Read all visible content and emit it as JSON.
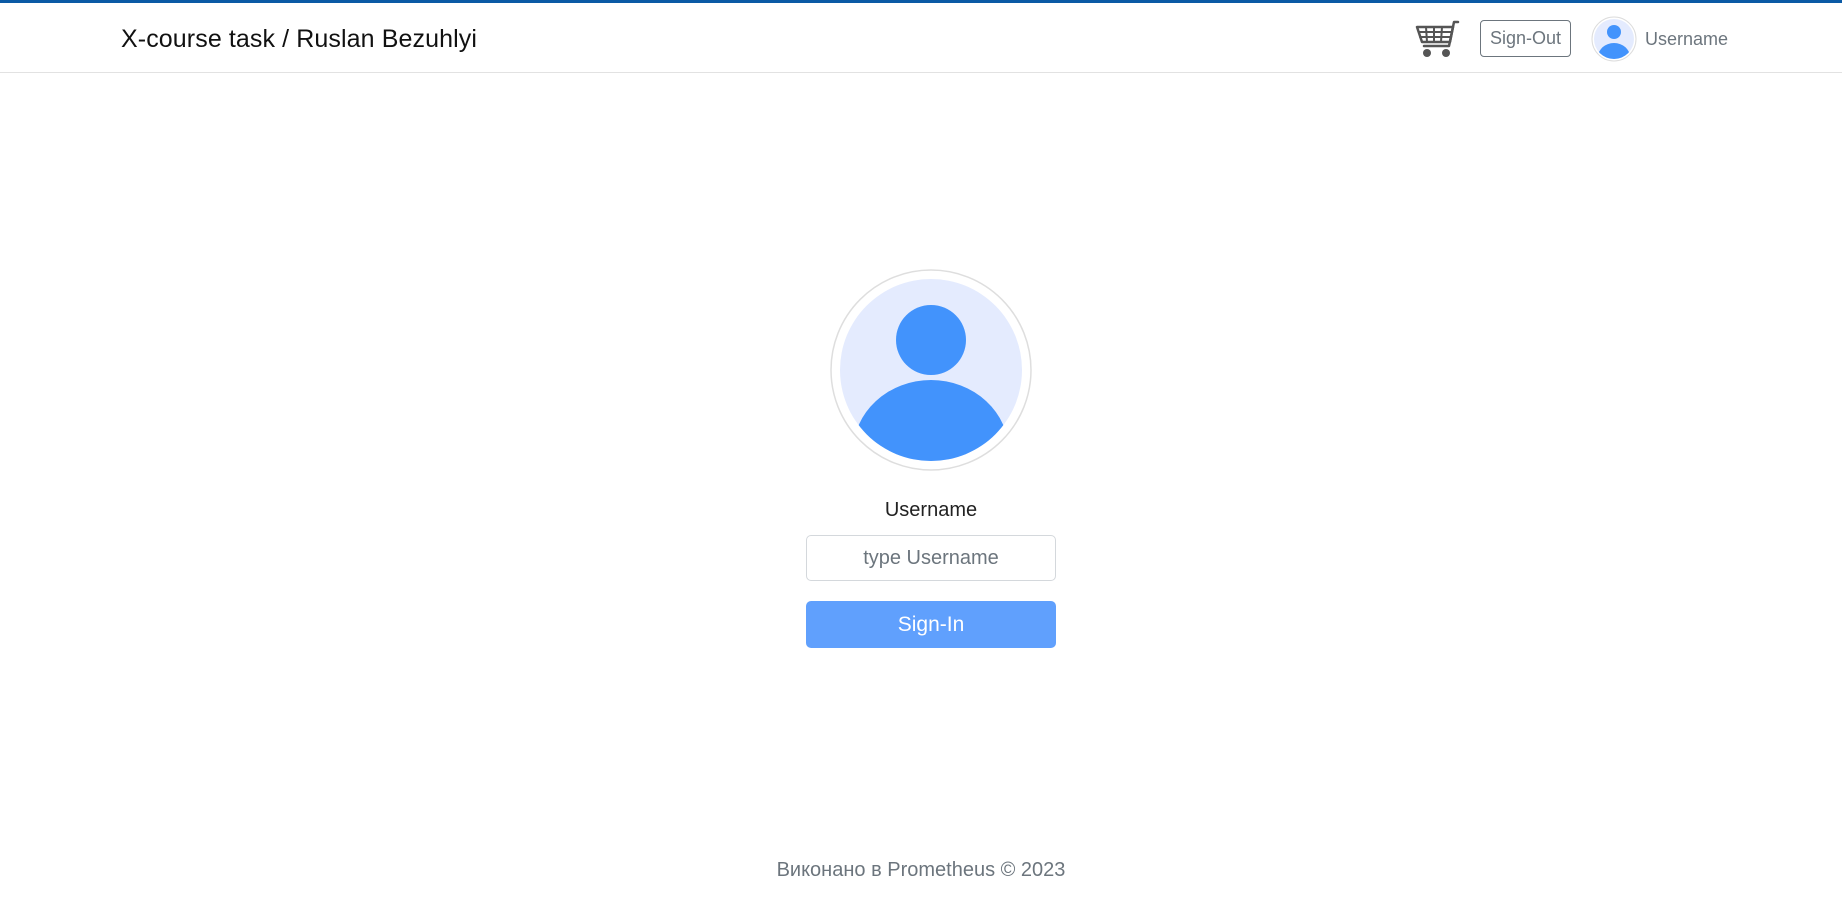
{
  "header": {
    "brand": "X-course task / Ruslan Bezuhlyi",
    "cart_icon": "shopping-cart-icon",
    "signout_label": "Sign-Out",
    "avatar_icon": "user-avatar-icon",
    "username": "Username"
  },
  "login": {
    "avatar_icon": "user-avatar-icon",
    "label": "Username",
    "input_placeholder": "type Username",
    "input_value": "",
    "signin_label": "Sign-In"
  },
  "footer": {
    "text": "Виконано в Prometheus © 2023"
  },
  "colors": {
    "accent_bar": "#0b5aa5",
    "avatar_blue": "#4293fc",
    "avatar_bg": "#e4ebfe",
    "signin_button": "#60a0fd",
    "muted_text": "#6c757d"
  }
}
